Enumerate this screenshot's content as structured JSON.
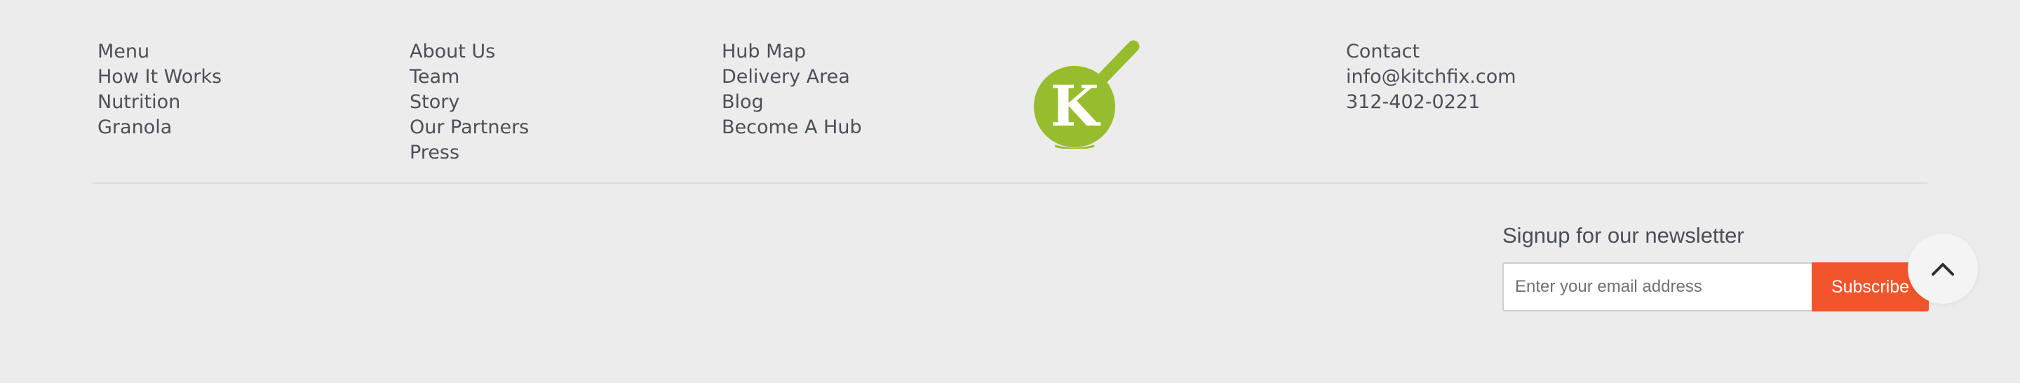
{
  "footer": {
    "col1": [
      "Menu",
      "How It Works",
      "Nutrition",
      "Granola"
    ],
    "col2": [
      "About Us",
      "Team",
      "Story",
      "Our Partners",
      "Press"
    ],
    "col3": [
      "Hub Map",
      "Delivery Area",
      "Blog",
      "Become A Hub"
    ],
    "contact": [
      "Contact",
      "info@kitchfix.com",
      "312-402-0221"
    ],
    "logo": {
      "letter": "K",
      "icon": "kitchfix-logo-icon",
      "color": "#97bc2d"
    }
  },
  "newsletter": {
    "title": "Signup for our newsletter",
    "placeholder": "Enter your email address",
    "value": "",
    "button_label": "Subscribe",
    "button_color": "#f2552c"
  },
  "scroll_top": {
    "icon": "chevron-up-icon"
  }
}
